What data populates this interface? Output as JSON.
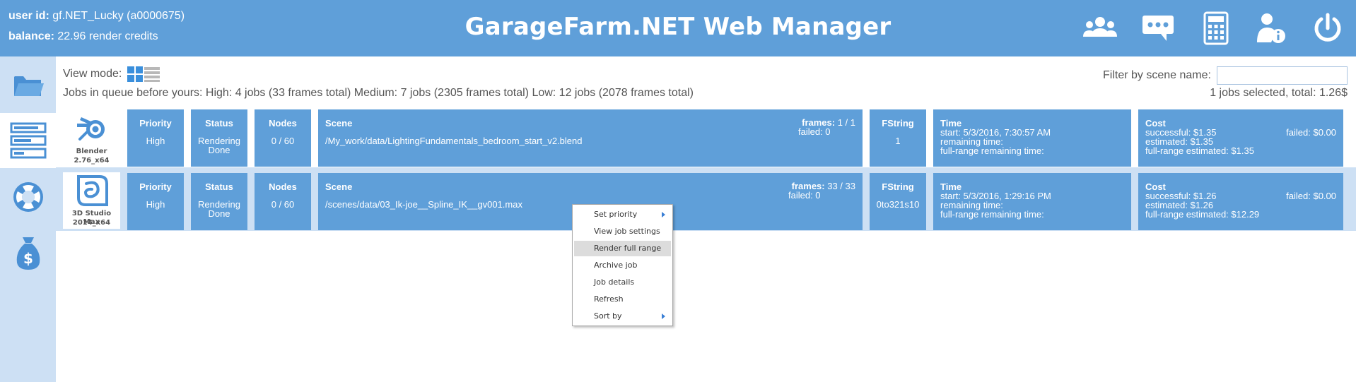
{
  "header": {
    "user_label": "user id:",
    "user_value": "gf.NET_Lucky (a0000675)",
    "balance_label": "balance:",
    "balance_value": "22.96  render credits",
    "title": "GarageFarm.NET Web Manager",
    "icons": [
      "users-icon",
      "chat-icon",
      "calculator-icon",
      "user-info-icon",
      "power-icon"
    ]
  },
  "sidebar": {
    "items": [
      "folder-icon",
      "jobs-list-icon",
      "lifebuoy-icon",
      "money-bag-icon"
    ],
    "active_index": 1
  },
  "toolbar": {
    "view_mode_label": "View mode:",
    "queue_text": "Jobs in queue before yours: High: 4 jobs (33 frames total)  Medium: 7 jobs (2305 frames total)  Low: 12 jobs (2078 frames total)",
    "filter_label": "Filter by scene name:",
    "filter_value": "",
    "selection_text": "1 jobs selected, total: 1.26$"
  },
  "column_headers": {
    "priority": "Priority",
    "status": "Status",
    "nodes": "Nodes",
    "scene": "Scene",
    "fstring": "FString",
    "time": "Time",
    "cost": "Cost"
  },
  "jobs": [
    {
      "app_name": "Blender",
      "app_version": "2.76_x64",
      "priority": "High",
      "status_line1": "Rendering",
      "status_line2": "Done",
      "nodes": "0 / 60",
      "scene_path": "/My_work/data/LightingFundamentals_bedroom_start_v2.blend",
      "frames_label": "frames:",
      "frames": "1 / 1",
      "failed": "failed: 0",
      "fstring": "1",
      "time_start": "start: 5/3/2016, 7:30:57 AM",
      "time_remaining": "remaining time:",
      "time_full_remaining": "full-range remaining time:",
      "cost_successful": "successful: $1.35",
      "cost_failed": "failed: $0.00",
      "cost_estimated": "estimated: $1.35",
      "cost_full_estimated": "full-range estimated: $1.35"
    },
    {
      "app_name": "3D Studio Max",
      "app_version": "2014_x64",
      "priority": "High",
      "status_line1": "Rendering",
      "status_line2": "Done",
      "nodes": "0 / 60",
      "scene_path": "/scenes/data/03_Ik-joe__Spline_IK__gv001.max",
      "frames_label": "frames:",
      "frames": "33 / 33",
      "failed": "failed: 0",
      "fstring": "0to321s10",
      "time_start": "start: 5/3/2016, 1:29:16 PM",
      "time_remaining": "remaining time:",
      "time_full_remaining": "full-range remaining time:",
      "cost_successful": "successful: $1.26",
      "cost_failed": "failed: $0.00",
      "cost_estimated": "estimated: $1.26",
      "cost_full_estimated": "full-range estimated: $12.29"
    }
  ],
  "context_menu": {
    "items": [
      {
        "label": "Set priority",
        "submenu": true
      },
      {
        "label": "View job settings",
        "submenu": false
      },
      {
        "label": "Render full range",
        "submenu": false,
        "highlighted": true
      },
      {
        "label": "Archive job",
        "submenu": false
      },
      {
        "label": "Job details",
        "submenu": false
      },
      {
        "label": "Refresh",
        "submenu": false
      },
      {
        "label": "Sort by",
        "submenu": true
      }
    ]
  },
  "colors": {
    "header_bg": "#5f9fd9",
    "sidebar_bg": "#cde0f4",
    "cell_bg": "#5f9fd9",
    "selected_row_bg": "#cde0f4"
  }
}
